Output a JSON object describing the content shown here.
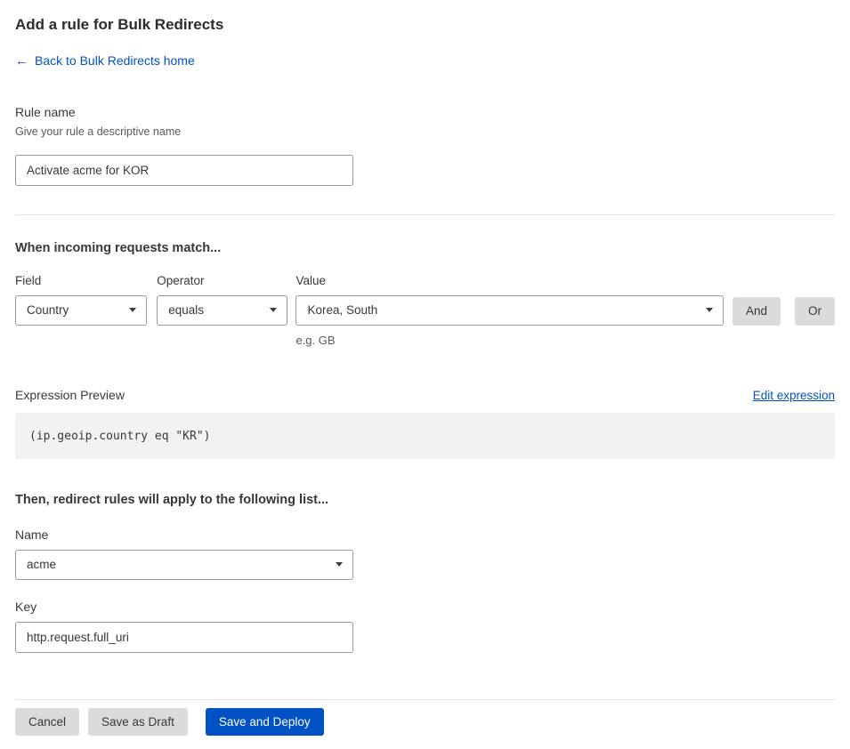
{
  "page": {
    "title": "Add a rule for Bulk Redirects",
    "back_link_label": "Back to Bulk Redirects home"
  },
  "rule_name": {
    "label": "Rule name",
    "help": "Give your rule a descriptive name",
    "value": "Activate acme for KOR"
  },
  "match": {
    "heading": "When incoming requests match...",
    "field_label": "Field",
    "field_value": "Country",
    "operator_label": "Operator",
    "operator_value": "equals",
    "value_label": "Value",
    "value_value": "Korea, South",
    "value_hint": "e.g. GB",
    "and_label": "And",
    "or_label": "Or"
  },
  "expression": {
    "label": "Expression Preview",
    "edit_link_label": "Edit expression",
    "code": "(ip.geoip.country eq \"KR\")"
  },
  "list": {
    "heading": "Then, redirect rules will apply to the following list...",
    "name_label": "Name",
    "name_value": "acme",
    "key_label": "Key",
    "key_value": "http.request.full_uri"
  },
  "actions": {
    "cancel_label": "Cancel",
    "save_draft_label": "Save as Draft",
    "save_deploy_label": "Save and Deploy"
  },
  "icons": {
    "back_arrow": "←"
  },
  "colors": {
    "link_blue": "#0051c3",
    "primary_button": "#0051c3",
    "secondary_button": "#dbdbdb",
    "code_background": "#f2f2f2",
    "input_border": "#999999",
    "text_dark": "#36393a",
    "text_muted": "#595959"
  }
}
